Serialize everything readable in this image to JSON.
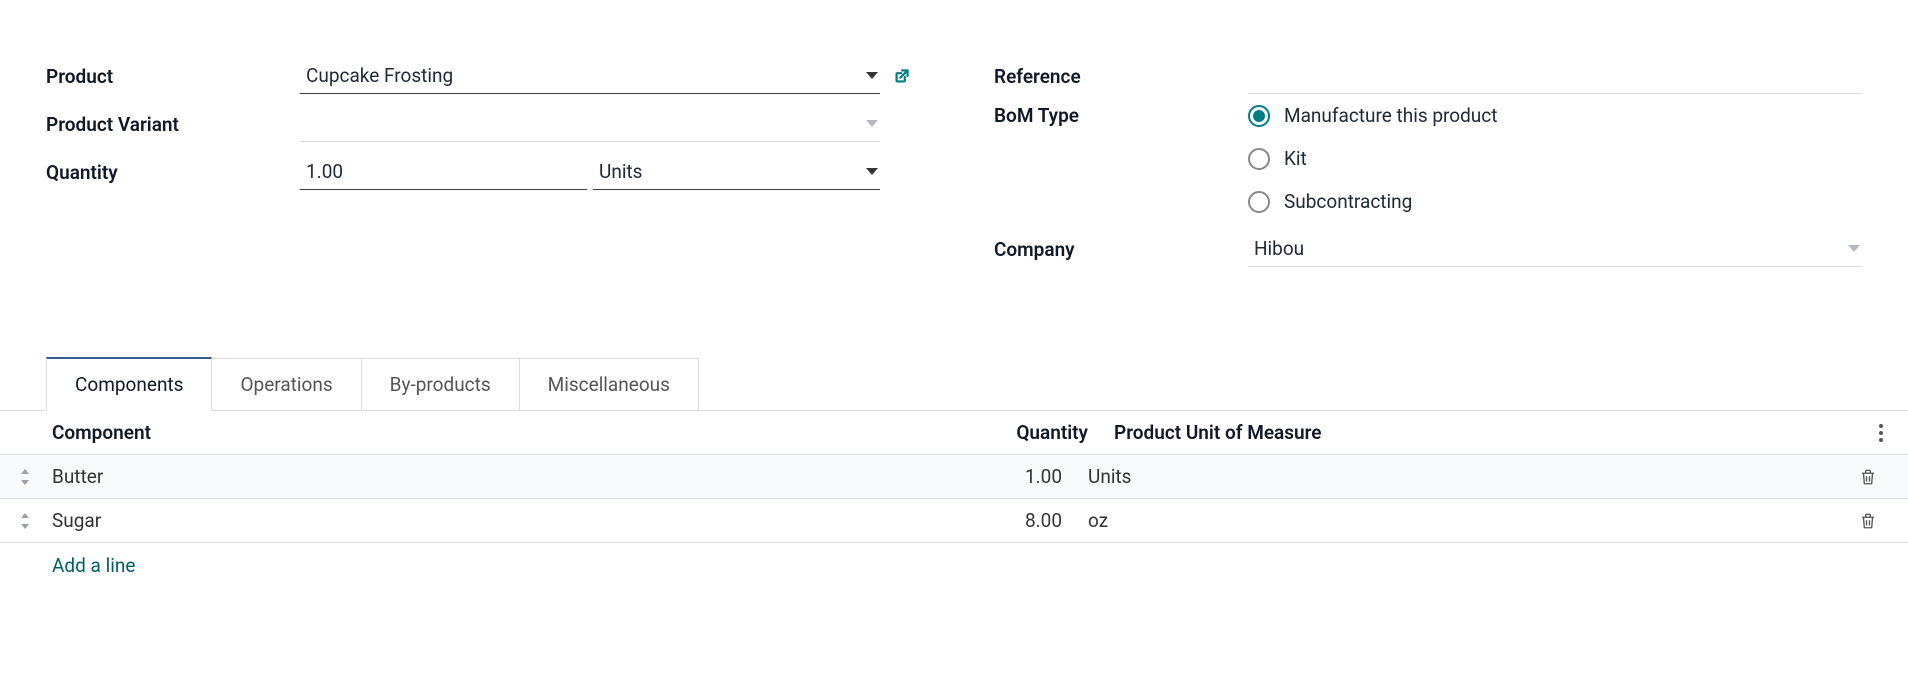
{
  "labels": {
    "product": "Product",
    "product_variant": "Product Variant",
    "quantity": "Quantity",
    "reference": "Reference",
    "bom_type": "BoM Type",
    "company": "Company"
  },
  "product": {
    "name": "Cupcake Frosting",
    "variant": ""
  },
  "quantity": {
    "value": "1.00",
    "uom": "Units"
  },
  "reference": "",
  "bom_type": {
    "options": {
      "manufacture": "Manufacture this product",
      "kit": "Kit",
      "subcontracting": "Subcontracting"
    },
    "selected": "manufacture"
  },
  "company": "Hibou",
  "tabs": {
    "components": "Components",
    "operations": "Operations",
    "byproducts": "By-products",
    "miscellaneous": "Miscellaneous",
    "active": "components"
  },
  "table": {
    "headers": {
      "component": "Component",
      "quantity": "Quantity",
      "uom": "Product Unit of Measure"
    },
    "rows": [
      {
        "component": "Butter",
        "quantity": "1.00",
        "uom": "Units"
      },
      {
        "component": "Sugar",
        "quantity": "8.00",
        "uom": "oz"
      }
    ],
    "add_line": "Add a line"
  }
}
